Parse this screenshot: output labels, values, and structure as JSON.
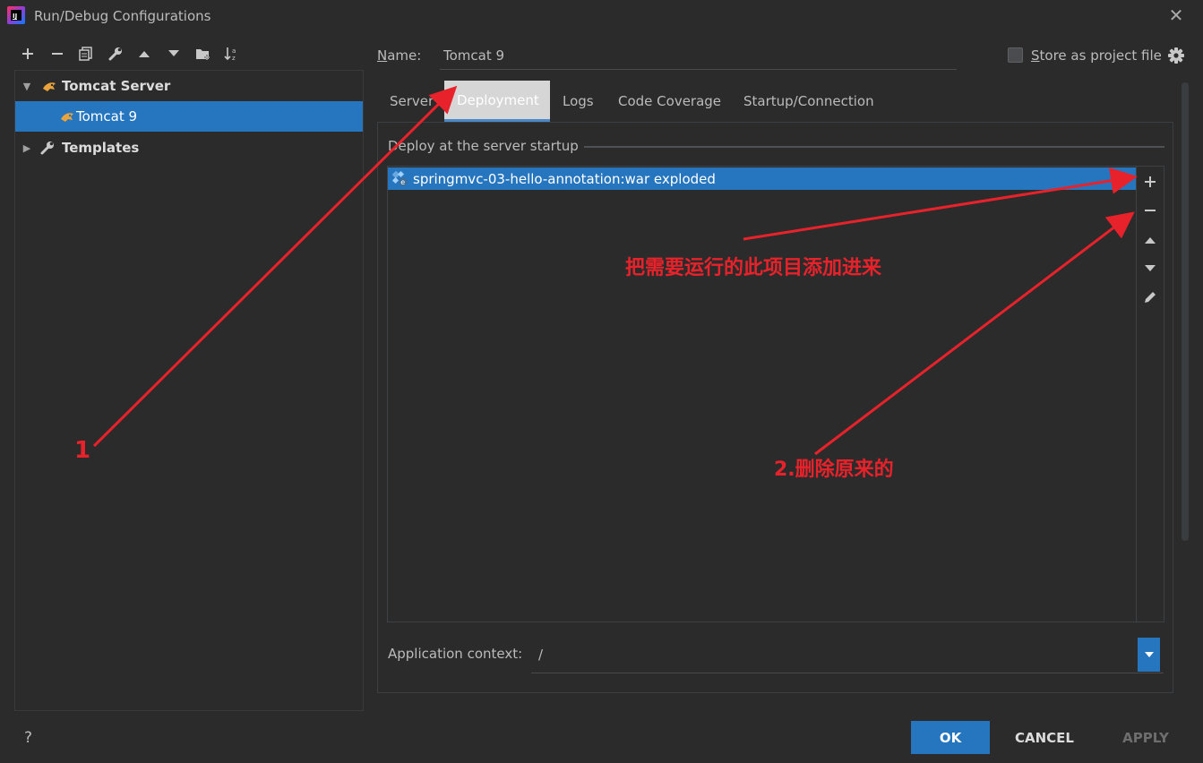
{
  "window": {
    "title": "Run/Debug Configurations",
    "icons": {
      "app": "intellij-icon",
      "close": "close-icon"
    }
  },
  "toolbar": {
    "buttons": [
      "add-icon",
      "remove-icon",
      "copy-icon",
      "wrench-icon",
      "move-up-icon",
      "move-down-icon",
      "new-folder-icon",
      "sort-alpha-icon"
    ]
  },
  "tree": {
    "items": [
      {
        "label": "Tomcat Server",
        "icon": "tomcat-icon",
        "expanded": true
      },
      {
        "label": "Tomcat 9",
        "icon": "tomcat-icon",
        "selected": true
      },
      {
        "label": "Templates",
        "icon": "wrench-icon",
        "expanded": false
      }
    ]
  },
  "config": {
    "name_label": "Name:",
    "name_value": "Tomcat 9",
    "store_label": "Store as project file",
    "store_checked": false
  },
  "tabs": [
    {
      "label": "Server",
      "active": false
    },
    {
      "label": "Deployment",
      "active": true
    },
    {
      "label": "Logs",
      "active": false
    },
    {
      "label": "Code Coverage",
      "active": false
    },
    {
      "label": "Startup/Connection",
      "active": false
    }
  ],
  "deployment": {
    "section_title": "Deploy at the server startup",
    "artifacts": [
      {
        "label": "springmvc-03-hello-annotation:war exploded",
        "icon": "artifact-icon",
        "selected": true
      }
    ],
    "side_buttons": [
      "add-icon",
      "remove-icon",
      "move-up-icon",
      "move-down-icon",
      "edit-icon"
    ],
    "context_label": "Application context:",
    "context_value": "/"
  },
  "footer": {
    "help": "?",
    "ok": "OK",
    "cancel": "CANCEL",
    "apply": "APPLY"
  },
  "annotations": {
    "step1": "1",
    "add_note": "把需要运行的此项目添加进来",
    "delete_note": "2.删除原来的"
  },
  "colors": {
    "background": "#2b2b2b",
    "selection": "#2675bf",
    "annotation": "#e8222b",
    "text": "#bbbbbb"
  }
}
